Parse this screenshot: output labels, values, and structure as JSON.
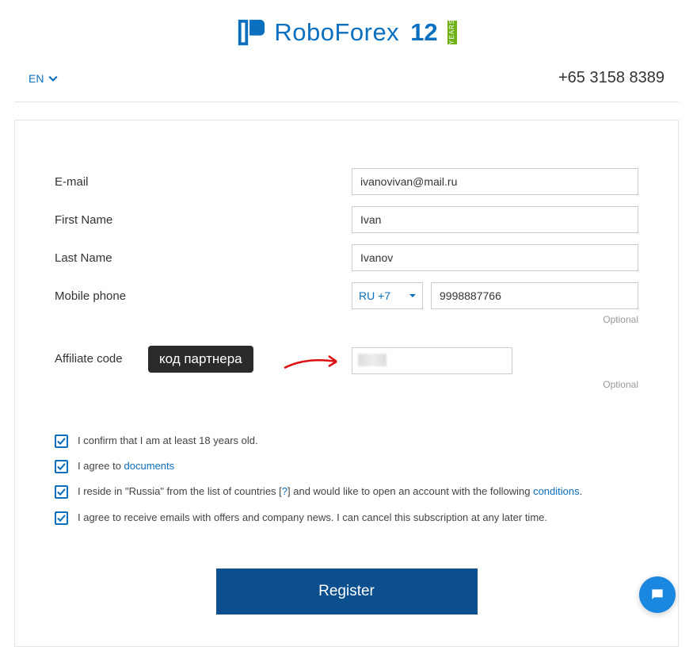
{
  "header": {
    "brand_name": "RoboForex",
    "anniversary_number": "12",
    "anniversary_label": "YEARS"
  },
  "topbar": {
    "language": "EN",
    "phone": "+65 3158 8389"
  },
  "form": {
    "email_label": "E-mail",
    "email_value": "ivanovivan@mail.ru",
    "firstname_label": "First Name",
    "firstname_value": "Ivan",
    "lastname_label": "Last Name",
    "lastname_value": "Ivanov",
    "mobile_label": "Mobile phone",
    "phone_code": "RU +7",
    "phone_value": "9998887766",
    "affiliate_label": "Affiliate code",
    "affiliate_value": "",
    "optional_text": "Optional",
    "tooltip_text": "код партнера"
  },
  "checks": {
    "c1": "I confirm that I am at least 18 years old.",
    "c2_pre": "I agree to ",
    "c2_link": "documents",
    "c3_pre": "I reside in \"Russia\" from the list of countries [",
    "c3_q": "?",
    "c3_mid": "] and would like to open an account with the following ",
    "c3_link": "conditions",
    "c3_end": ".",
    "c4": "I agree to receive emails with offers and company news. I can cancel this subscription at any later time."
  },
  "buttons": {
    "register": "Register"
  }
}
